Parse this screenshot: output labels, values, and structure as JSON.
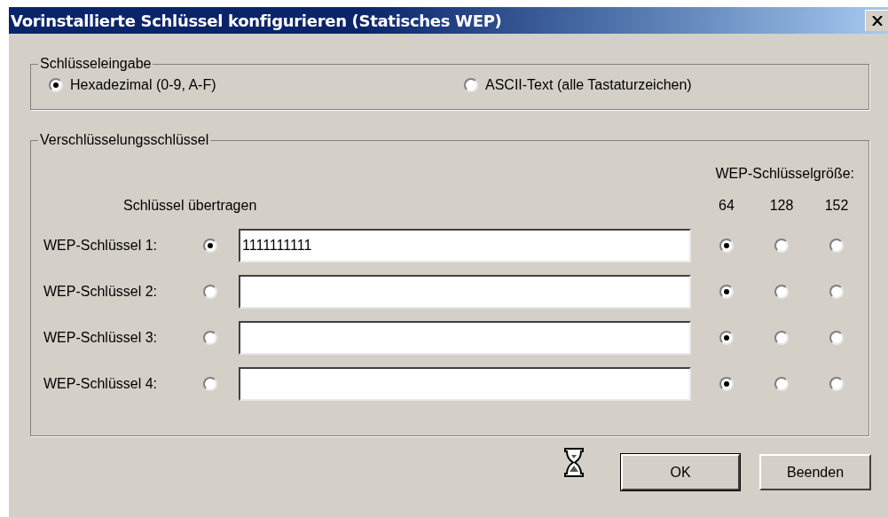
{
  "window": {
    "title": "Vorinstallierte Schlüssel konfigurieren (Statisches WEP)"
  },
  "key_input": {
    "legend": "Schlüsseleingabe",
    "options": [
      {
        "label": "Hexadezimal (0-9, A-F)",
        "selected": true
      },
      {
        "label": "ASCII-Text (alle Tastaturzeichen)",
        "selected": false
      }
    ]
  },
  "encryption_keys": {
    "legend": "Verschlüsselungsschlüssel",
    "size_heading": "WEP-Schlüsselgröße:",
    "transmit_heading": "Schlüssel übertragen",
    "sizes": [
      "64",
      "128",
      "152"
    ],
    "keys": [
      {
        "label": "WEP-Schlüssel 1:",
        "selected": true,
        "value": "1111111111",
        "size_options": [
          {
            "selected": true
          },
          {
            "selected": false
          },
          {
            "selected": false
          }
        ]
      },
      {
        "label": "WEP-Schlüssel 2:",
        "selected": false,
        "size_options": [
          {
            "selected": true
          },
          {
            "selected": false
          },
          {
            "selected": false
          }
        ]
      },
      {
        "label": "WEP-Schlüssel 3:",
        "selected": false,
        "size_options": [
          {
            "selected": true
          },
          {
            "selected": false
          },
          {
            "selected": false
          }
        ]
      },
      {
        "label": "WEP-Schlüssel 4:",
        "selected": false,
        "size_options": [
          {
            "selected": true
          },
          {
            "selected": false
          },
          {
            "selected": false
          }
        ]
      }
    ]
  },
  "buttons": [
    {
      "label": "OK",
      "default": true
    },
    {
      "label": "Beenden",
      "default": false
    }
  ]
}
